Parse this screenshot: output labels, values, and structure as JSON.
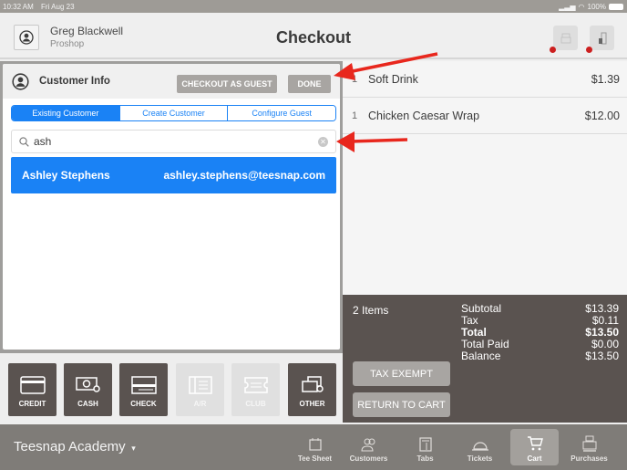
{
  "status_bar": {
    "time": "10:32 AM",
    "date": "Fri Aug 23",
    "battery": "100%"
  },
  "header": {
    "user_name": "Greg Blackwell",
    "user_role": "Proshop",
    "title": "Checkout",
    "icons": [
      "printer-icon",
      "cash-drawer-icon"
    ]
  },
  "customer_panel": {
    "title": "Customer Info",
    "checkout_as_guest_label": "CHECKOUT AS GUEST",
    "done_label": "DONE",
    "tabs": [
      {
        "label": "Existing Customer",
        "active": true
      },
      {
        "label": "Create Customer",
        "active": false
      },
      {
        "label": "Configure Guest",
        "active": false
      }
    ],
    "search": {
      "value": "ash",
      "placeholder": ""
    },
    "results": [
      {
        "name": "Ashley Stephens",
        "email": "ashley.stephens@teesnap.com"
      }
    ]
  },
  "payment_buttons": [
    {
      "label": "CREDIT",
      "icon": "credit-card-icon",
      "enabled": true
    },
    {
      "label": "CASH",
      "icon": "cash-icon",
      "enabled": true
    },
    {
      "label": "CHECK",
      "icon": "check-icon",
      "enabled": true
    },
    {
      "label": "A/R",
      "icon": "ledger-icon",
      "enabled": false
    },
    {
      "label": "CLUB",
      "icon": "ticket-icon",
      "enabled": false
    },
    {
      "label": "OTHER",
      "icon": "cards-icon",
      "enabled": true
    }
  ],
  "cart": {
    "items": [
      {
        "qty": "1",
        "name": "Soft Drink",
        "price": "$1.39"
      },
      {
        "qty": "1",
        "name": "Chicken Caesar Wrap",
        "price": "$12.00"
      }
    ]
  },
  "totals": {
    "items_count": "2 Items",
    "subtotal_label": "Subtotal",
    "subtotal": "$13.39",
    "tax_label": "Tax",
    "tax": "$0.11",
    "total_label": "Total",
    "total": "$13.50",
    "total_paid_label": "Total Paid",
    "total_paid": "$0.00",
    "balance_label": "Balance",
    "balance": "$13.50",
    "tax_exempt_label": "TAX EXEMPT",
    "return_to_cart_label": "RETURN TO CART"
  },
  "nav": {
    "venue": "Teesnap Academy",
    "items": [
      {
        "label": "Tee Sheet",
        "active": false
      },
      {
        "label": "Customers",
        "active": false
      },
      {
        "label": "Tabs",
        "active": false
      },
      {
        "label": "Tickets",
        "active": false
      },
      {
        "label": "Cart",
        "active": true
      },
      {
        "label": "Purchases",
        "active": false
      }
    ]
  },
  "colors": {
    "accent": "#1a82f5",
    "dark": "#5a5350",
    "nav": "#7f7c78",
    "annotation": "#e8271d"
  }
}
